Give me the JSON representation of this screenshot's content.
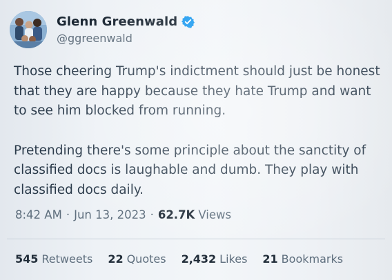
{
  "author": {
    "display_name": "Glenn Greenwald",
    "handle": "@ggreenwald",
    "verified_color": "#1d9bf0"
  },
  "tweet": {
    "paragraphs": [
      "Those cheering Trump's indictment should just be honest that they are happy because they hate Trump and want to see him blocked from running.",
      "Pretending there's some principle about the sanctity of classified docs is laughable and dumb. They play with classified docs daily."
    ],
    "time": "8:42 AM",
    "date": "Jun 13, 2023",
    "views_count": "62.7K",
    "views_label": "Views"
  },
  "stats": {
    "retweets": {
      "count": "545",
      "label": "Retweets"
    },
    "quotes": {
      "count": "22",
      "label": "Quotes"
    },
    "likes": {
      "count": "2,432",
      "label": "Likes"
    },
    "bookmarks": {
      "count": "21",
      "label": "Bookmarks"
    }
  }
}
